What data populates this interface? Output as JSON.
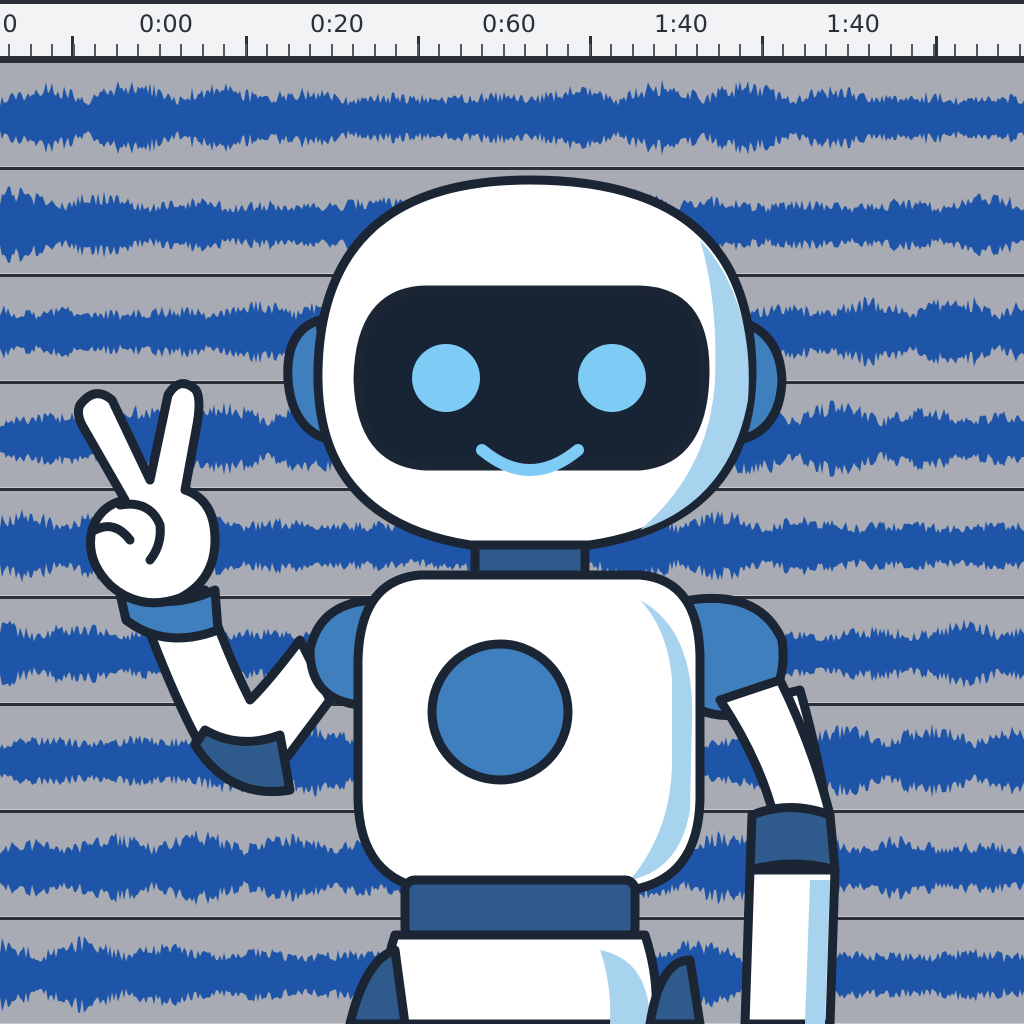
{
  "timeline": {
    "ticks": [
      {
        "label": "0"
      },
      {
        "label": "0:00"
      },
      {
        "label": "0:20"
      },
      {
        "label": "0:60"
      },
      {
        "label": "1:40"
      },
      {
        "label": "1:40"
      }
    ]
  },
  "tracks": {
    "count": 9,
    "waveform_color": "#1f55a8",
    "track_color": "#a8abb3"
  },
  "mascot": {
    "icon": "robot-peace-sign-icon",
    "colors": {
      "body": "#ffffff",
      "shade": "#a7d3ef",
      "accent": "#3f7fbd",
      "visor": "#172436",
      "eyes": "#7ecbf5",
      "outline": "#1b2533"
    }
  }
}
